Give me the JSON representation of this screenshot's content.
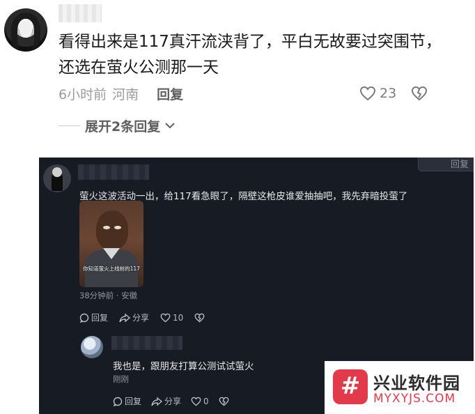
{
  "top_comment": {
    "text": "看得出来是117真汗流浃背了，平白无故要过突围节，还选在萤火公测那一天",
    "time": "6小时前",
    "location": "河南",
    "reply_label": "回复",
    "like_count": "23",
    "expand_label": "展开2条回复"
  },
  "embedded": {
    "top_chip_label": "回复",
    "comment": {
      "text": "萤火这波活动一出，给117看急眼了，隔壁这枪皮谁爱抽抽吧，我先弃暗投萤了",
      "image_caption": "你知道萤火上线前的117",
      "time_location": "38分钟前 · 安徽",
      "reply_label": "回复",
      "share_label": "分享",
      "like_count": "10"
    },
    "reply": {
      "text": "我也是，跟朋友打算公测试试萤火",
      "time": "刚刚",
      "reply_label": "回复",
      "share_label": "分享",
      "like_count": "0"
    }
  },
  "watermark": {
    "logo_char": "#",
    "title": "兴业软件园",
    "url": "MYXYJS.COM",
    "brand_color": "#e23a4a"
  },
  "icons": [
    "heart-icon",
    "heart-broken-icon",
    "chevron-down-icon",
    "chat-icon",
    "share-icon"
  ]
}
